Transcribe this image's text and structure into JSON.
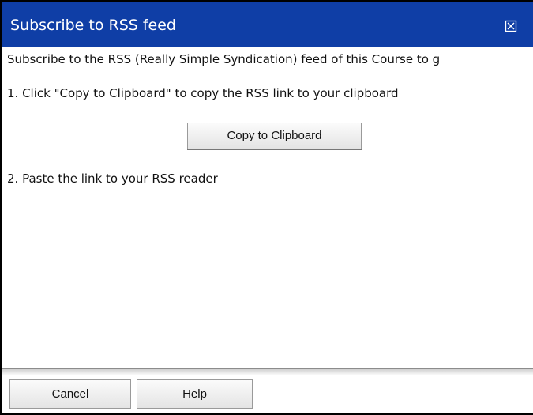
{
  "dialog": {
    "title": "Subscribe to RSS feed",
    "close_icon": "close-icon",
    "intro_text": "Subscribe to the RSS (Really Simple Syndication) feed of this Course to g",
    "step1_text": "1. Click \"Copy to Clipboard\" to copy the RSS link to your clipboard",
    "copy_button_label": "Copy to Clipboard",
    "step2_text": "2. Paste the link to your RSS reader",
    "cancel_button_label": "Cancel",
    "help_button_label": "Help"
  },
  "colors": {
    "title_bar": "#0f3ea6",
    "title_text": "#ffffff"
  }
}
